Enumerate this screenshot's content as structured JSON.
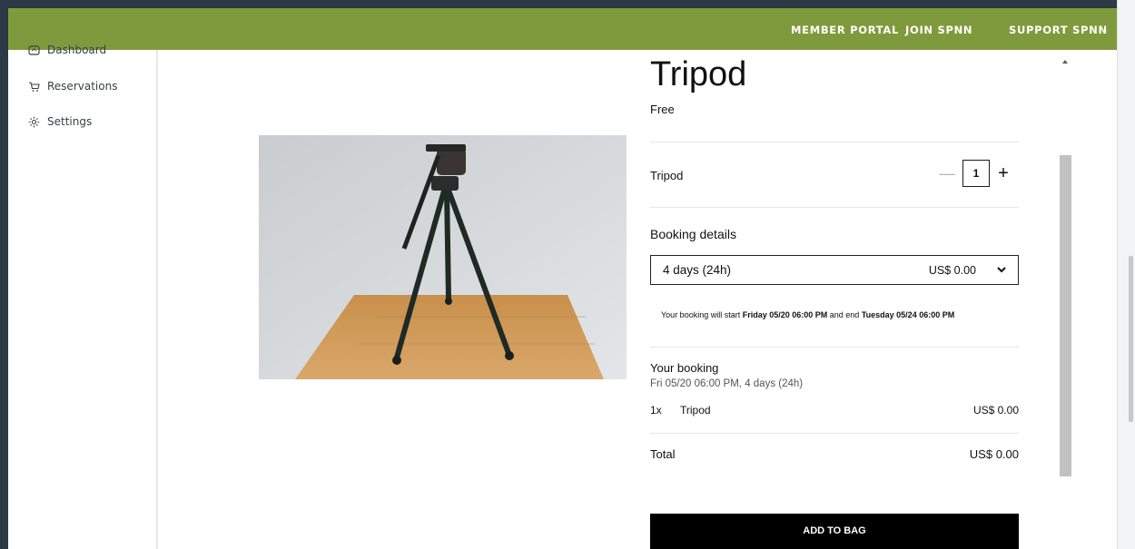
{
  "nav": {
    "links": [
      "MEMBER PORTAL",
      "JOIN SPNN",
      "SUPPORT SPNN"
    ],
    "bar_color": "#7f9a3c"
  },
  "sidebar": {
    "items": [
      {
        "label": "Dashboard",
        "icon": "dashboard-icon"
      },
      {
        "label": "Reservations",
        "icon": "cart-icon"
      },
      {
        "label": "Settings",
        "icon": "gear-icon"
      }
    ]
  },
  "product": {
    "title": "Tripod",
    "price_label": "Free",
    "image_alt": "tripod-photo"
  },
  "item": {
    "name": "Tripod",
    "quantity": "1",
    "minus": "—",
    "plus": "+"
  },
  "booking": {
    "label": "Booking details",
    "selected_option": "4 days (24h)",
    "option_price": "US$ 0.00",
    "note_prefix": "Your booking will start ",
    "note_start": "Friday 05/20 06:00 PM",
    "note_middle": " and end ",
    "note_end": "Tuesday 05/24 06:00 PM"
  },
  "summary": {
    "heading": "Your booking",
    "subheading": "Fri 05/20 06:00 PM, 4 days (24h)",
    "line_qty": "1x",
    "line_name": "Tripod",
    "line_price": "US$ 0.00",
    "total_label": "Total",
    "total_value": "US$ 0.00"
  },
  "actions": {
    "add_to_bag": "ADD TO BAG"
  }
}
